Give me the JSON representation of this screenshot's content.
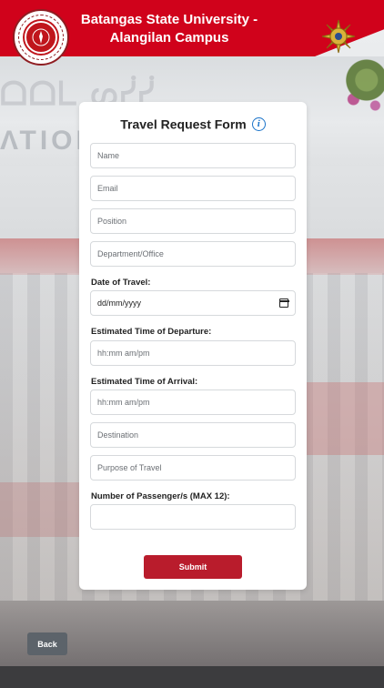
{
  "header": {
    "title_line1": "Batangas State University -",
    "title_line2": "Alangilan Campus",
    "logo_icon": "university-seal-icon",
    "emblem_icon": "campus-emblem-icon"
  },
  "form": {
    "title": "Travel Request Form",
    "info_icon": "info-icon",
    "fields": {
      "name_placeholder": "Name",
      "email_placeholder": "Email",
      "position_placeholder": "Position",
      "department_placeholder": "Department/Office",
      "date_label": "Date of Travel:",
      "date_value": "dd/mm/yyyy",
      "departure_label": "Estimated Time of Departure:",
      "departure_placeholder": "hh:mm am/pm",
      "arrival_label": "Estimated Time of Arrival:",
      "arrival_placeholder": "hh:mm am/pm",
      "destination_placeholder": "Destination",
      "purpose_placeholder": "Purpose of Travel",
      "passengers_label": "Number of Passenger/s (MAX 12):",
      "passengers_value": ""
    },
    "submit_label": "Submit"
  },
  "back_label": "Back",
  "colors": {
    "header_red": "#d0021b",
    "submit_red": "#b91c2c",
    "back_gray": "#5c636a",
    "info_blue": "#1a73c9",
    "footer": "#3c3c3e"
  }
}
